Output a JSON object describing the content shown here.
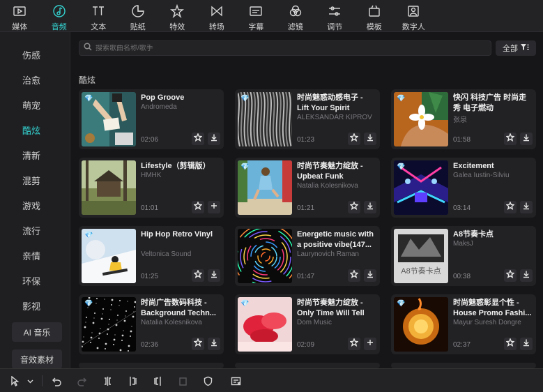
{
  "toolbar": [
    {
      "label": "媒体",
      "icon": "media-icon"
    },
    {
      "label": "音频",
      "icon": "audio-icon",
      "active": true
    },
    {
      "label": "文本",
      "icon": "text-icon"
    },
    {
      "label": "贴纸",
      "icon": "sticker-icon"
    },
    {
      "label": "特效",
      "icon": "effects-icon"
    },
    {
      "label": "转场",
      "icon": "transition-icon"
    },
    {
      "label": "字幕",
      "icon": "subtitle-icon"
    },
    {
      "label": "滤镜",
      "icon": "filter-icon"
    },
    {
      "label": "调节",
      "icon": "adjust-icon"
    },
    {
      "label": "模板",
      "icon": "template-icon"
    },
    {
      "label": "数字人",
      "icon": "digital-human-icon"
    }
  ],
  "sidebar": {
    "items": [
      "伤感",
      "治愈",
      "萌宠",
      "酷炫",
      "清新",
      "混剪",
      "游戏",
      "流行",
      "亲情",
      "环保",
      "影视"
    ],
    "active": "酷炫",
    "buttons": [
      "AI 音乐",
      "音效素材"
    ]
  },
  "search": {
    "placeholder": "搜索歌曲名称/歌手"
  },
  "filter": {
    "label": "全部"
  },
  "section": {
    "title": "酷炫"
  },
  "tracks": [
    {
      "title": "Pop Groove",
      "artist": "Andromeda",
      "duration": "02:06",
      "premium": true,
      "action": "download"
    },
    {
      "title": "时尚魅惑动感电子 - Lift Your Spirit",
      "artist": "ALEKSANDAR KIPROV",
      "duration": "01:23",
      "premium": true,
      "action": "download"
    },
    {
      "title": "快闪 科技广告 时尚走秀 电子燃动",
      "artist": "张泉",
      "duration": "01:58",
      "premium": true,
      "action": "download"
    },
    {
      "title": "Lifestyle（剪辑版）",
      "artist": "HMHK",
      "duration": "01:01",
      "premium": false,
      "action": "add"
    },
    {
      "title": "时尚节奏魅力绽放 - Upbeat Funk",
      "artist": "Natalia Kolesnikova",
      "duration": "01:21",
      "premium": true,
      "action": "download"
    },
    {
      "title": "Excitement",
      "artist": "Galea Iustin-Silviu",
      "duration": "03:14",
      "premium": true,
      "action": "download"
    },
    {
      "title": "Hip Hop Retro Vinyl",
      "artist": "Veltonica Sound",
      "duration": "01:25",
      "premium": true,
      "action": "download"
    },
    {
      "title": "Energetic music with a positive vibe(147...",
      "artist": "Laurynovich Raman",
      "duration": "01:47",
      "premium": false,
      "action": "download"
    },
    {
      "title": "A8节奏卡点",
      "artist": "MaksJ",
      "duration": "00:38",
      "premium": false,
      "action": "download"
    },
    {
      "title": "时尚广告数码科技 - Background Techn...",
      "artist": "Natalia Kolesnikova",
      "duration": "02:36",
      "premium": true,
      "action": "download"
    },
    {
      "title": "时尚节奏魅力绽放 - Only Time Will Tell",
      "artist": "Dom Music",
      "duration": "02:09",
      "premium": true,
      "action": "add"
    },
    {
      "title": "时尚魅惑彰显个性 - House Promo Fashi...",
      "artist": "Mayur Suresh Dongre",
      "duration": "02:37",
      "premium": true,
      "action": "download"
    }
  ],
  "thumb_art": {
    "t3_caption": "A8节奏卡点"
  }
}
